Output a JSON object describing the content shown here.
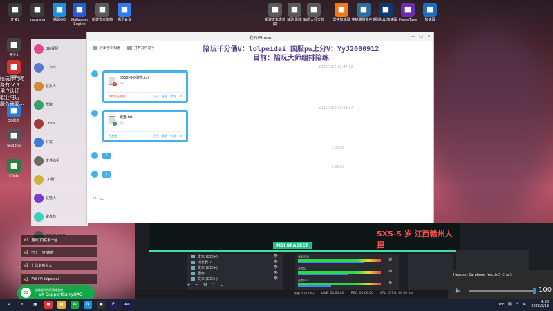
{
  "desktop": {
    "top_icons": [
      {
        "label": "开关2",
        "icon": "toggle-icon",
        "color": "#3b3b3b"
      },
      {
        "label": "xiaoyang",
        "icon": "user-icon",
        "color": "#3b3b3b"
      },
      {
        "label": "腾讯QQ",
        "icon": "qq-icon",
        "color": "#1b8fe0"
      },
      {
        "label": "Wallpaper Engine",
        "icon": "wallpaper-icon",
        "color": "#2a5bd7"
      },
      {
        "label": "新建文本文档",
        "icon": "text-doc-icon",
        "color": "#5a5a5a"
      },
      {
        "label": "腾讯会议",
        "icon": "meeting-icon",
        "color": "#2d7cf6"
      },
      {
        "label": "新建文本文档 (2)",
        "icon": "text-doc-icon",
        "color": "#5a5a5a"
      },
      {
        "label": "辅助 副本",
        "icon": "text-doc-icon",
        "color": "#5a5a5a"
      },
      {
        "label": "辅助大师文档",
        "icon": "text-doc-icon",
        "color": "#5a5a5a"
      },
      {
        "label": "雷神加速器",
        "icon": "thunder-icon",
        "color": "#f07a1a"
      },
      {
        "label": "英雄联盟客户端",
        "icon": "lol-icon",
        "color": "#2a6ea0"
      },
      {
        "label": "网易UU加速器",
        "icon": "uu-icon",
        "color": "#0b3a6b"
      },
      {
        "label": "PowerToys",
        "icon": "powertoys-icon",
        "color": "#6a2fb0"
      },
      {
        "label": "加速器",
        "icon": "globe-icon",
        "color": "#1b6fc0"
      }
    ],
    "left_icons": [
      {
        "label": "命令1",
        "icon": "cmd-icon",
        "color": "#444"
      },
      {
        "label": "PDF",
        "icon": "pdf-icon",
        "color": "#d0342c"
      },
      {
        "label": "QQ影音",
        "icon": "video-icon",
        "color": "#2a7be0"
      },
      {
        "label": "SGB365",
        "icon": "app-icon",
        "color": "#555"
      },
      {
        "label": "Crisis",
        "icon": "game-icon",
        "color": "#2a7f3a"
      }
    ]
  },
  "chat": {
    "title": "我的iPhone",
    "toolbar": [
      "导出手机相册",
      "打开文件助手"
    ],
    "overlay_lines": [
      "陪玩千分俑V：lolpeidai 国服pw上分V：YyJ2000912",
      "目前：陪玩大师组排陪练"
    ],
    "timestamps": [
      "2022/5/17 22:47:02",
      "2022/5/18 19:59:17",
      "1:06:50",
      "4:25:52"
    ],
    "files": [
      {
        "name": "0518MKO聚盘.txt",
        "size": "0B",
        "status": "文件打开失败",
        "status_color": "#d33",
        "actions": [
          "打开",
          "复制",
          "转发"
        ]
      },
      {
        "name": "聚盘.txt",
        "size": "0B",
        "status": "已发送",
        "status_color": "#1aa34a",
        "actions": [
          "打开",
          "复制",
          "转发"
        ]
      }
    ],
    "mini_bubbles": [
      "1",
      "1"
    ],
    "bottom_tools": [
      "✂",
      "▭"
    ],
    "controls": [
      "—",
      "□",
      "✕"
    ]
  },
  "contacts": [
    {
      "name": "B站视频",
      "color": "#e04a8a"
    },
    {
      "name": "二次元",
      "color": "#5a78d0"
    },
    {
      "name": "联系人",
      "color": "#d08a3a"
    },
    {
      "name": "群聊",
      "color": "#3aa06a"
    },
    {
      "name": "Crisis",
      "color": "#a03a3a"
    },
    {
      "name": "好友",
      "color": "#3a80d0"
    },
    {
      "name": "文件助手",
      "color": "#6a6a6a"
    },
    {
      "name": "QQ群",
      "color": "#d0b03a"
    },
    {
      "name": "联络人",
      "color": "#7a3ad0"
    },
    {
      "name": "聚盘的",
      "color": "#3ad0c0"
    },
    {
      "name": "暗无道 SWH",
      "color": "#555"
    }
  ],
  "side_notes": [
    "陪玩师用昵",
    "务有:V 5...",
    "用户认证",
    "职业陪玩",
    "服务需要..."
  ],
  "obs": {
    "badge": "MSI BRACKET",
    "red_text": "5X5-5 岁 江西赣州人捏",
    "sources": [
      "文本 (GDI+)",
      "浏览器 2",
      "文本 (GDI+)",
      "图像",
      "文本 (GDI+)"
    ],
    "mixers": [
      {
        "label": "桌面音频",
        "level": 0.8
      },
      {
        "label": "麦克风",
        "level": 0.6
      },
      {
        "label": "麦克风2",
        "level": 0.4
      }
    ],
    "status": [
      "丢帧 0 (0.0%)",
      "LIVE: 00:00:00",
      "REC: 00:00:00",
      "CPU: 5.7%, 60.00 fps"
    ],
    "bottom_tools": [
      "+",
      "−",
      "⚙",
      "⌃",
      "⌄"
    ]
  },
  "volume": {
    "device": "Headset Earphone (Arctis 5 Chat)",
    "value": "100",
    "level": 1.0
  },
  "overlays": {
    "wechat_label": "加微信代你打网络游戏",
    "wechat_id": "+VX SupportCarryQAQ",
    "hype_rows": [
      {
        "count": "x1",
        "text": "游戏QQ联系一区"
      },
      {
        "count": "x1",
        "text": "打上一刀·铸造"
      },
      {
        "count": "x1",
        "text": "上法剑有大大"
      },
      {
        "count": "x1",
        "text": "PW+V: lolpeidai"
      }
    ]
  },
  "taskbar": {
    "apps": [
      {
        "name": "start-icon",
        "glyph": "⊞",
        "color": "#1b2333"
      },
      {
        "name": "search-icon",
        "glyph": "⌕",
        "color": "#1b2333"
      },
      {
        "name": "task-view-icon",
        "glyph": "▣",
        "color": "#1b2333"
      },
      {
        "name": "chrome-icon",
        "glyph": "●",
        "color": "#d33"
      },
      {
        "name": "explorer-icon",
        "glyph": "▤",
        "color": "#e0b030"
      },
      {
        "name": "wechat-icon",
        "glyph": "✉",
        "color": "#15a84a"
      },
      {
        "name": "qq-icon",
        "glyph": "Q",
        "color": "#1b8fe0"
      },
      {
        "name": "obs-icon",
        "glyph": "◉",
        "color": "#333"
      },
      {
        "name": "premiere-icon",
        "glyph": "Pr",
        "color": "#2a1a5a"
      },
      {
        "name": "ae-icon",
        "glyph": "Ae",
        "color": "#1a1a4a"
      }
    ],
    "weather": "18°C 阴",
    "time": "4:38",
    "date": "2022/5/19"
  }
}
